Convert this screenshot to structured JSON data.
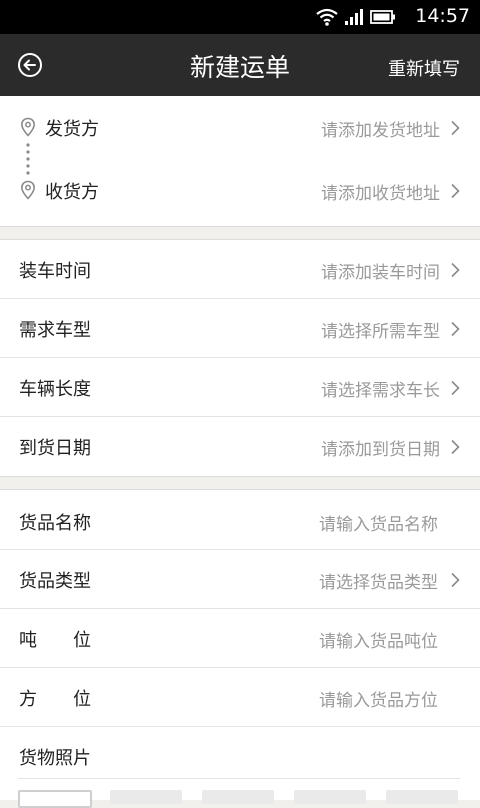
{
  "status_bar": {
    "time": "14:57"
  },
  "header": {
    "title": "新建运单",
    "reset_label": "重新填写",
    "back_icon": "back-circle-icon"
  },
  "address": {
    "sender_label": "发货方",
    "sender_hint": "请添加发货地址",
    "receiver_label": "收货方",
    "receiver_hint": "请添加收货地址"
  },
  "vehicle": {
    "rows": [
      {
        "label": "装车时间",
        "hint": "请添加装车时间"
      },
      {
        "label": "需求车型",
        "hint": "请选择所需车型"
      },
      {
        "label": "车辆长度",
        "hint": "请选择需求车长"
      },
      {
        "label": "到货日期",
        "hint": "请添加到货日期"
      }
    ]
  },
  "cargo": {
    "name_label": "货品名称",
    "name_placeholder": "请输入货品名称",
    "type_label": "货品类型",
    "type_hint": "请选择货品类型",
    "tonnage_label": "吨　　位",
    "tonnage_placeholder": "请输入货品吨位",
    "volume_label": "方　　位",
    "volume_placeholder": "请输入货品方位",
    "photos_label": "货物照片"
  },
  "colors": {
    "titlebar": "#2b2b2b",
    "hint": "#9a9a9a",
    "page_bg": "#f2f0ec"
  }
}
